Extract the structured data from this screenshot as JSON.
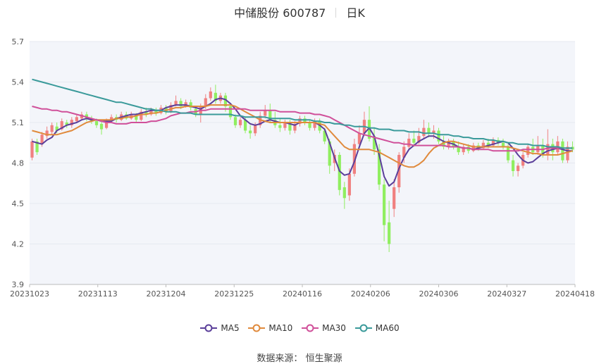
{
  "header": {
    "stock_name": "中储股份 600787",
    "period": "日K"
  },
  "source": {
    "label": "数据来源：",
    "value": "恒生聚源"
  },
  "colors": {
    "up": "#f08080",
    "down": "#90ee60",
    "ma5": "#5b3f9a",
    "ma10": "#e08a3c",
    "ma30": "#d0509a",
    "ma60": "#3a9a9a",
    "plot_bg": "#f3f5fa",
    "grid": "#e6e9f0"
  },
  "chart_data": {
    "type": "candlestick",
    "ylim": [
      3.9,
      5.7
    ],
    "yticks": [
      3.9,
      4.2,
      4.5,
      4.8,
      5.1,
      5.4,
      5.7
    ],
    "x_tick_labels": [
      "20231023",
      "20231113",
      "20231204",
      "20231225",
      "20240116",
      "20240206",
      "20240306",
      "20240327",
      "20240418"
    ],
    "legend": [
      {
        "name": "MA5",
        "color_key": "ma5"
      },
      {
        "name": "MA10",
        "color_key": "ma10"
      },
      {
        "name": "MA30",
        "color_key": "ma30"
      },
      {
        "name": "MA60",
        "color_key": "ma60"
      }
    ],
    "candles": [
      [
        4.84,
        4.96,
        4.82,
        4.98
      ],
      [
        4.96,
        4.88,
        4.86,
        4.98
      ],
      [
        4.94,
        5.01,
        4.92,
        5.03
      ],
      [
        5.0,
        5.04,
        4.98,
        5.07
      ],
      [
        5.03,
        5.08,
        5.01,
        5.1
      ],
      [
        5.07,
        5.04,
        5.02,
        5.1
      ],
      [
        5.05,
        5.11,
        5.04,
        5.13
      ],
      [
        5.1,
        5.08,
        5.06,
        5.12
      ],
      [
        5.08,
        5.12,
        5.06,
        5.14
      ],
      [
        5.11,
        5.14,
        5.1,
        5.16
      ],
      [
        5.13,
        5.16,
        5.12,
        5.18
      ],
      [
        5.16,
        5.13,
        5.11,
        5.18
      ],
      [
        5.13,
        5.11,
        5.09,
        5.15
      ],
      [
        5.11,
        5.08,
        5.06,
        5.13
      ],
      [
        5.09,
        5.05,
        5.01,
        5.11
      ],
      [
        5.06,
        5.11,
        5.05,
        5.13
      ],
      [
        5.11,
        5.14,
        5.1,
        5.16
      ],
      [
        5.14,
        5.12,
        5.1,
        5.16
      ],
      [
        5.12,
        5.16,
        5.11,
        5.18
      ],
      [
        5.16,
        5.13,
        5.12,
        5.18
      ],
      [
        5.13,
        5.16,
        5.12,
        5.18
      ],
      [
        5.15,
        5.12,
        5.1,
        5.17
      ],
      [
        5.12,
        5.18,
        5.11,
        5.2
      ],
      [
        5.18,
        5.16,
        5.14,
        5.21
      ],
      [
        5.16,
        5.19,
        5.15,
        5.21
      ],
      [
        5.19,
        5.17,
        5.15,
        5.21
      ],
      [
        5.17,
        5.21,
        5.16,
        5.23
      ],
      [
        5.21,
        5.18,
        5.16,
        5.23
      ],
      [
        5.18,
        5.23,
        5.17,
        5.25
      ],
      [
        5.23,
        5.26,
        5.22,
        5.3
      ],
      [
        5.26,
        5.22,
        5.2,
        5.28
      ],
      [
        5.22,
        5.25,
        5.21,
        5.27
      ],
      [
        5.25,
        5.21,
        5.19,
        5.27
      ],
      [
        5.2,
        5.16,
        5.14,
        5.22
      ],
      [
        5.16,
        5.22,
        5.1,
        5.24
      ],
      [
        5.22,
        5.28,
        5.2,
        5.31
      ],
      [
        5.28,
        5.33,
        5.26,
        5.36
      ],
      [
        5.32,
        5.26,
        5.24,
        5.38
      ],
      [
        5.26,
        5.3,
        5.24,
        5.32
      ],
      [
        5.3,
        5.22,
        5.18,
        5.32
      ],
      [
        5.22,
        5.14,
        5.12,
        5.24
      ],
      [
        5.14,
        5.08,
        5.06,
        5.16
      ],
      [
        5.08,
        5.12,
        5.06,
        5.14
      ],
      [
        5.12,
        5.04,
        5.02,
        5.14
      ],
      [
        5.04,
        5.02,
        4.98,
        5.08
      ],
      [
        5.02,
        5.08,
        5.0,
        5.1
      ],
      [
        5.08,
        5.15,
        5.06,
        5.18
      ],
      [
        5.15,
        5.19,
        5.13,
        5.23
      ],
      [
        5.19,
        5.12,
        5.1,
        5.24
      ],
      [
        5.12,
        5.08,
        5.06,
        5.18
      ],
      [
        5.08,
        5.06,
        5.03,
        5.13
      ],
      [
        5.06,
        5.1,
        5.04,
        5.12
      ],
      [
        5.1,
        5.04,
        5.01,
        5.12
      ],
      [
        5.04,
        5.09,
        5.02,
        5.11
      ],
      [
        5.09,
        5.13,
        5.07,
        5.15
      ],
      [
        5.13,
        5.1,
        5.08,
        5.15
      ],
      [
        5.1,
        5.06,
        5.04,
        5.12
      ],
      [
        5.06,
        5.11,
        5.04,
        5.13
      ],
      [
        5.11,
        5.04,
        5.02,
        5.13
      ],
      [
        5.04,
        4.96,
        4.94,
        5.06
      ],
      [
        4.96,
        4.78,
        4.72,
        4.98
      ],
      [
        4.8,
        4.86,
        4.74,
        4.9
      ],
      [
        4.86,
        4.6,
        4.56,
        4.88
      ],
      [
        4.62,
        4.54,
        4.46,
        4.66
      ],
      [
        4.56,
        4.72,
        4.52,
        4.76
      ],
      [
        4.72,
        4.94,
        4.7,
        4.98
      ],
      [
        4.94,
        5.02,
        4.92,
        5.08
      ],
      [
        5.02,
        5.12,
        5.0,
        5.18
      ],
      [
        5.12,
        4.98,
        4.96,
        5.22
      ],
      [
        5.0,
        4.9,
        4.86,
        5.06
      ],
      [
        4.9,
        4.64,
        4.6,
        4.94
      ],
      [
        4.64,
        4.34,
        4.22,
        4.68
      ],
      [
        4.36,
        4.2,
        4.14,
        4.52
      ],
      [
        4.46,
        4.62,
        4.4,
        4.68
      ],
      [
        4.62,
        4.86,
        4.58,
        4.88
      ],
      [
        4.84,
        4.92,
        4.8,
        4.96
      ],
      [
        4.92,
        4.98,
        4.9,
        5.02
      ],
      [
        4.98,
        4.95,
        4.92,
        5.04
      ],
      [
        4.95,
        5.0,
        4.94,
        5.06
      ],
      [
        5.0,
        5.06,
        4.98,
        5.12
      ],
      [
        5.06,
        5.02,
        4.99,
        5.1
      ],
      [
        5.02,
        5.04,
        4.98,
        5.08
      ],
      [
        5.04,
        4.96,
        4.94,
        5.06
      ],
      [
        4.96,
        4.92,
        4.9,
        5.0
      ],
      [
        4.92,
        4.96,
        4.9,
        4.98
      ],
      [
        4.96,
        4.92,
        4.9,
        4.98
      ],
      [
        4.92,
        4.88,
        4.86,
        4.96
      ],
      [
        4.88,
        4.92,
        4.86,
        4.94
      ],
      [
        4.92,
        4.89,
        4.87,
        4.94
      ],
      [
        4.89,
        4.93,
        4.88,
        4.95
      ],
      [
        4.93,
        4.91,
        4.89,
        4.95
      ],
      [
        4.91,
        4.95,
        4.9,
        4.97
      ],
      [
        4.95,
        4.93,
        4.91,
        4.98
      ],
      [
        4.93,
        4.97,
        4.92,
        4.99
      ],
      [
        4.97,
        4.95,
        4.93,
        4.99
      ],
      [
        4.95,
        4.92,
        4.9,
        4.98
      ],
      [
        4.92,
        4.82,
        4.8,
        4.94
      ],
      [
        4.82,
        4.74,
        4.7,
        4.86
      ],
      [
        4.74,
        4.78,
        4.7,
        4.8
      ],
      [
        4.78,
        4.86,
        4.76,
        4.88
      ],
      [
        4.86,
        4.92,
        4.84,
        4.94
      ],
      [
        4.92,
        4.88,
        4.86,
        4.98
      ],
      [
        4.88,
        4.93,
        4.86,
        5.0
      ],
      [
        4.93,
        4.86,
        4.84,
        4.98
      ],
      [
        4.86,
        4.94,
        4.82,
        5.05
      ],
      [
        4.94,
        4.88,
        4.82,
        4.98
      ],
      [
        4.88,
        4.96,
        4.86,
        5.0
      ],
      [
        4.96,
        4.82,
        4.8,
        4.98
      ],
      [
        4.82,
        4.92,
        4.8,
        4.96
      ],
      [
        4.92,
        4.9,
        4.88,
        4.96
      ]
    ],
    "series": [
      {
        "name": "MA5",
        "values": [
          4.96,
          4.95,
          4.94,
          4.97,
          4.99,
          5.04,
          5.06,
          5.08,
          5.09,
          5.1,
          5.12,
          5.13,
          5.12,
          5.12,
          5.11,
          5.11,
          5.11,
          5.13,
          5.14,
          5.15,
          5.16,
          5.16,
          5.17,
          5.18,
          5.19,
          5.19,
          5.19,
          5.21,
          5.22,
          5.23,
          5.23,
          5.23,
          5.22,
          5.21,
          5.2,
          5.22,
          5.24,
          5.27,
          5.28,
          5.27,
          5.24,
          5.2,
          5.15,
          5.12,
          5.09,
          5.08,
          5.09,
          5.11,
          5.12,
          5.11,
          5.1,
          5.1,
          5.09,
          5.08,
          5.1,
          5.1,
          5.1,
          5.1,
          5.08,
          5.05,
          4.95,
          4.84,
          4.74,
          4.71,
          4.72,
          4.81,
          4.92,
          5.02,
          5.06,
          5.0,
          4.86,
          4.7,
          4.63,
          4.66,
          4.76,
          4.84,
          4.9,
          4.93,
          4.96,
          4.98,
          5.0,
          5.0,
          4.98,
          4.96,
          4.95,
          4.94,
          4.92,
          4.91,
          4.91,
          4.9,
          4.91,
          4.92,
          4.93,
          4.94,
          4.95,
          4.96,
          4.95,
          4.91,
          4.86,
          4.82,
          4.8,
          4.81,
          4.84,
          4.87,
          4.89,
          4.9,
          4.91,
          4.9,
          4.89,
          4.89
        ]
      },
      {
        "name": "MA10",
        "values": [
          5.04,
          5.03,
          5.02,
          5.01,
          5.01,
          5.01,
          5.02,
          5.03,
          5.04,
          5.06,
          5.08,
          5.1,
          5.11,
          5.12,
          5.12,
          5.12,
          5.12,
          5.13,
          5.13,
          5.14,
          5.14,
          5.15,
          5.16,
          5.16,
          5.17,
          5.17,
          5.18,
          5.19,
          5.2,
          5.21,
          5.21,
          5.22,
          5.22,
          5.22,
          5.22,
          5.22,
          5.23,
          5.23,
          5.23,
          5.23,
          5.23,
          5.22,
          5.2,
          5.18,
          5.16,
          5.14,
          5.12,
          5.11,
          5.1,
          5.1,
          5.1,
          5.1,
          5.1,
          5.1,
          5.1,
          5.1,
          5.1,
          5.1,
          5.09,
          5.08,
          5.04,
          5.0,
          4.96,
          4.92,
          4.9,
          4.9,
          4.9,
          4.9,
          4.9,
          4.89,
          4.88,
          4.86,
          4.84,
          4.82,
          4.8,
          4.78,
          4.77,
          4.77,
          4.79,
          4.82,
          4.87,
          4.91,
          4.93,
          4.95,
          4.96,
          4.96,
          4.95,
          4.94,
          4.93,
          4.92,
          4.92,
          4.92,
          4.92,
          4.92,
          4.92,
          4.92,
          4.92,
          4.91,
          4.9,
          4.89,
          4.88,
          4.87,
          4.87,
          4.86,
          4.86,
          4.86,
          4.86,
          4.87,
          4.88,
          4.89
        ]
      },
      {
        "name": "MA30",
        "values": [
          5.22,
          5.21,
          5.2,
          5.2,
          5.19,
          5.19,
          5.18,
          5.18,
          5.17,
          5.16,
          5.15,
          5.14,
          5.13,
          5.12,
          5.11,
          5.1,
          5.1,
          5.09,
          5.09,
          5.09,
          5.1,
          5.1,
          5.1,
          5.1,
          5.11,
          5.11,
          5.12,
          5.13,
          5.15,
          5.16,
          5.17,
          5.17,
          5.18,
          5.18,
          5.19,
          5.19,
          5.2,
          5.2,
          5.2,
          5.2,
          5.2,
          5.2,
          5.2,
          5.2,
          5.19,
          5.19,
          5.19,
          5.19,
          5.19,
          5.19,
          5.18,
          5.18,
          5.18,
          5.18,
          5.17,
          5.17,
          5.17,
          5.16,
          5.16,
          5.15,
          5.14,
          5.12,
          5.1,
          5.08,
          5.06,
          5.04,
          5.02,
          5.01,
          5.0,
          4.99,
          4.98,
          4.97,
          4.96,
          4.95,
          4.95,
          4.94,
          4.94,
          4.93,
          4.93,
          4.93,
          4.93,
          4.93,
          4.93,
          4.93,
          4.92,
          4.92,
          4.92,
          4.91,
          4.91,
          4.9,
          4.9,
          4.9,
          4.9,
          4.89,
          4.89,
          4.89,
          4.89,
          4.89,
          4.89,
          4.9,
          4.9,
          4.9,
          4.9,
          4.9,
          4.91,
          4.91,
          4.91,
          4.91,
          4.91,
          4.91
        ]
      },
      {
        "name": "MA60",
        "values": [
          5.42,
          5.41,
          5.4,
          5.39,
          5.38,
          5.37,
          5.36,
          5.35,
          5.34,
          5.33,
          5.32,
          5.31,
          5.3,
          5.29,
          5.28,
          5.27,
          5.26,
          5.25,
          5.25,
          5.24,
          5.23,
          5.22,
          5.21,
          5.2,
          5.2,
          5.19,
          5.19,
          5.18,
          5.18,
          5.18,
          5.17,
          5.17,
          5.17,
          5.16,
          5.16,
          5.16,
          5.16,
          5.16,
          5.16,
          5.16,
          5.16,
          5.15,
          5.15,
          5.14,
          5.14,
          5.14,
          5.14,
          5.14,
          5.13,
          5.13,
          5.13,
          5.13,
          5.13,
          5.12,
          5.12,
          5.12,
          5.12,
          5.11,
          5.11,
          5.1,
          5.1,
          5.09,
          5.09,
          5.08,
          5.08,
          5.07,
          5.07,
          5.07,
          5.06,
          5.06,
          5.05,
          5.05,
          5.05,
          5.04,
          5.04,
          5.04,
          5.03,
          5.03,
          5.03,
          5.02,
          5.02,
          5.02,
          5.01,
          5.01,
          5.01,
          5.0,
          5.0,
          4.99,
          4.99,
          4.98,
          4.98,
          4.98,
          4.97,
          4.97,
          4.96,
          4.96,
          4.95,
          4.95,
          4.94,
          4.94,
          4.94,
          4.93,
          4.93,
          4.93,
          4.92,
          4.92,
          4.92,
          4.91,
          4.91,
          4.91
        ]
      }
    ]
  }
}
